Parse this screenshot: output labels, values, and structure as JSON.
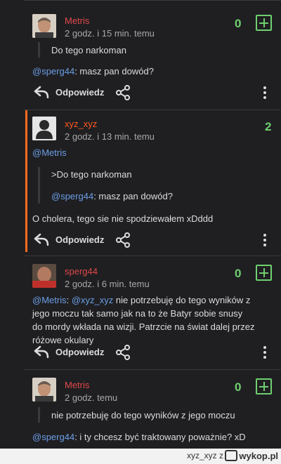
{
  "comments": [
    {
      "author": "Metris",
      "time": "2 godz. i 15 min. temu",
      "score": "0",
      "quote": "Do tego narkoman",
      "reply_mention": "@sperg44",
      "reply_text": ": masz pan dowód?",
      "reply_label": "Odpowiedz"
    },
    {
      "author": "xyz_xyz",
      "time": "2 godz. i 13 min. temu",
      "score": "2",
      "mention": "@Metris",
      "quote_line1": ">Do tego narkoman",
      "quote_mention": "@sperg44",
      "quote_text": ": masz pan dowód?",
      "body": "O cholera, tego sie nie spodziewałem  xDddd",
      "reply_label": "Odpowiedz"
    },
    {
      "author": "sperg44",
      "time": "2 godz. i 6 min. temu",
      "score": "0",
      "mention1": "@Metris",
      "sep": ": ",
      "mention2": "@xyz_xyz",
      "body_line1": "  nie potrzebuję do tego wyników z",
      "body_line2": "jego moczu tak samo jak na to że Batyr sobie snusy",
      "body_line3": "do mordy wkłada na wizji. Patrzcie na świat dalej przez",
      "body_line4": "różowe okulary",
      "reply_label": "Odpowiedz"
    },
    {
      "author": "Metris",
      "time": "2 godz. temu",
      "score": "0",
      "quote": "nie potrzebuję do tego wyników z jego moczu",
      "reply_mention": "@sperg44",
      "reply_text": ": i ty chcesz być traktowany poważnie? xD"
    }
  ],
  "footer": {
    "text": "xyz_xyz z",
    "logo": "wykop.pl"
  },
  "icons": [
    "plus-box-icon",
    "reply-icon",
    "share-icon",
    "more-vertical-icon",
    "user-placeholder-icon"
  ],
  "colors": {
    "score": "#6fd06f",
    "mention": "#6b9ee6",
    "author_red": "#e04848",
    "author_orange": "#ff5a1f",
    "accent": "#ff6a1f"
  }
}
